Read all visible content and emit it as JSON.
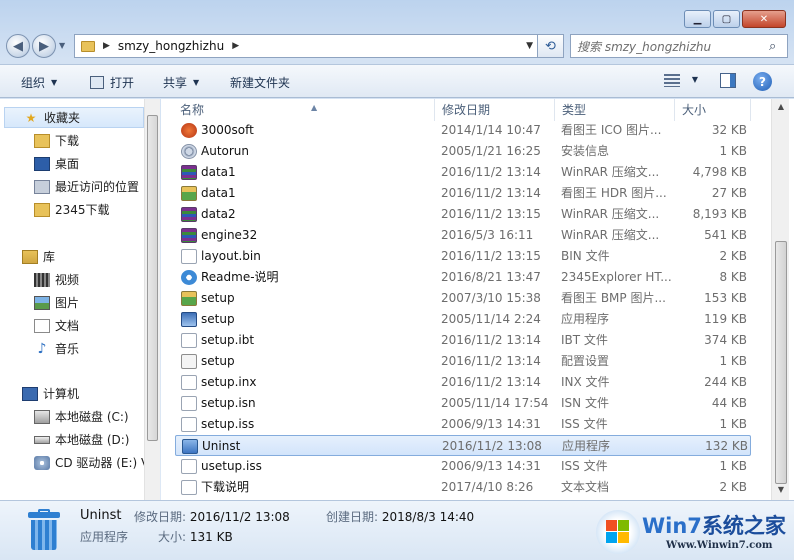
{
  "address": {
    "crumbs": [
      "smzy_hongzhizhu"
    ],
    "search_placeholder": "搜索 smzy_hongzhizhu"
  },
  "toolbar": {
    "organize": "组织",
    "open": "打开",
    "share": "共享",
    "new_folder": "新建文件夹"
  },
  "nav": {
    "favorites": "收藏夹",
    "fav_items": [
      "下载",
      "桌面",
      "最近访问的位置",
      "2345下载"
    ],
    "libraries": "库",
    "lib_items": [
      "视频",
      "图片",
      "文档",
      "音乐"
    ],
    "computer": "计算机",
    "drives": [
      "本地磁盘 (C:)",
      "本地磁盘 (D:)",
      "CD 驱动器 (E:) V"
    ]
  },
  "columns": {
    "name": "名称",
    "date": "修改日期",
    "type": "类型",
    "size": "大小"
  },
  "files": [
    {
      "name": "3000soft",
      "date": "2014/1/14 10:47",
      "type": "看图王 ICO 图片...",
      "size": "32 KB",
      "icon": "orange-ico-icon"
    },
    {
      "name": "Autorun",
      "date": "2005/1/21 16:25",
      "type": "安装信息",
      "size": "1 KB",
      "icon": "gear-doc-icon"
    },
    {
      "name": "data1",
      "date": "2016/11/2 13:14",
      "type": "WinRAR 压缩文...",
      "size": "4,798 KB",
      "icon": "winrar-icon"
    },
    {
      "name": "data1",
      "date": "2016/11/2 13:14",
      "type": "看图王 HDR 图片...",
      "size": "27 KB",
      "icon": "image-icon"
    },
    {
      "name": "data2",
      "date": "2016/11/2 13:15",
      "type": "WinRAR 压缩文...",
      "size": "8,193 KB",
      "icon": "winrar-icon"
    },
    {
      "name": "engine32",
      "date": "2016/5/3 16:11",
      "type": "WinRAR 压缩文...",
      "size": "541 KB",
      "icon": "winrar-icon"
    },
    {
      "name": "layout.bin",
      "date": "2016/11/2 13:15",
      "type": "BIN 文件",
      "size": "2 KB",
      "icon": "document-icon"
    },
    {
      "name": "Readme-说明",
      "date": "2016/8/21 13:47",
      "type": "2345Explorer HT...",
      "size": "8 KB",
      "icon": "browser-icon"
    },
    {
      "name": "setup",
      "date": "2007/3/10 15:38",
      "type": "看图王 BMP 图片...",
      "size": "153 KB",
      "icon": "image-icon"
    },
    {
      "name": "setup",
      "date": "2005/11/14 2:24",
      "type": "应用程序",
      "size": "119 KB",
      "icon": "application-icon"
    },
    {
      "name": "setup.ibt",
      "date": "2016/11/2 13:14",
      "type": "IBT 文件",
      "size": "374 KB",
      "icon": "document-icon"
    },
    {
      "name": "setup",
      "date": "2016/11/2 13:14",
      "type": "配置设置",
      "size": "1 KB",
      "icon": "config-icon"
    },
    {
      "name": "setup.inx",
      "date": "2016/11/2 13:14",
      "type": "INX 文件",
      "size": "244 KB",
      "icon": "document-icon"
    },
    {
      "name": "setup.isn",
      "date": "2005/11/14 17:54",
      "type": "ISN 文件",
      "size": "44 KB",
      "icon": "document-icon"
    },
    {
      "name": "setup.iss",
      "date": "2006/9/13 14:31",
      "type": "ISS 文件",
      "size": "1 KB",
      "icon": "document-icon"
    },
    {
      "name": "Uninst",
      "date": "2016/11/2 13:08",
      "type": "应用程序",
      "size": "132 KB",
      "icon": "uninstall-icon",
      "selected": true
    },
    {
      "name": "usetup.iss",
      "date": "2006/9/13 14:31",
      "type": "ISS 文件",
      "size": "1 KB",
      "icon": "document-icon"
    },
    {
      "name": "下载说明",
      "date": "2017/4/10 8:26",
      "type": "文本文档",
      "size": "2 KB",
      "icon": "document-icon"
    }
  ],
  "details": {
    "name": "Uninst",
    "type": "应用程序",
    "modified_label": "修改日期:",
    "modified_value": "2016/11/2 13:08",
    "created_label": "创建日期:",
    "created_value": "2018/8/3 14:40",
    "size_label": "大小:",
    "size_value": "131 KB"
  },
  "watermark": {
    "brand_a": "Win7",
    "brand_b": "系统之家",
    "url": "Www.Winwin7.com"
  },
  "colors": {
    "selection_border": "#84acdd",
    "selection_fill": "#d2e4fb",
    "toolbar_text": "#1e3351"
  }
}
